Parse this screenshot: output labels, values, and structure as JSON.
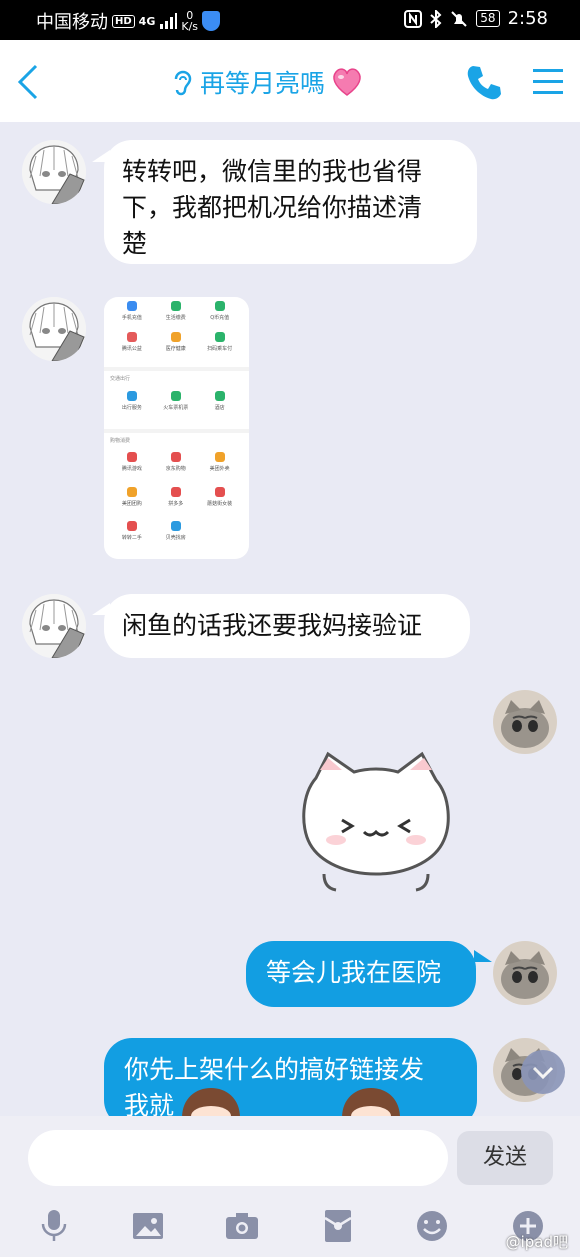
{
  "status_bar": {
    "carrier": "中国移动",
    "hd_badge": "HD",
    "network": "4G",
    "net_speed_value": "0",
    "net_speed_unit": "K/s",
    "battery": "58",
    "time": "2:58"
  },
  "header": {
    "title": "再等月亮嗎",
    "icons": [
      "back-icon",
      "ear-icon",
      "heart-icon",
      "phone-icon",
      "menu-icon"
    ]
  },
  "messages": [
    {
      "side": "in",
      "type": "text",
      "lines": [
        "转转吧，微信里的我也省得",
        "下，我都把机况给你描述清",
        "楚"
      ]
    },
    {
      "side": "in",
      "type": "image",
      "sections": [
        {
          "title": "",
          "items": [
            "手机充值",
            "生活缴费",
            "Q币充值",
            "城市服务",
            "腾讯公益",
            "医疗健康",
            "扫码乘车付"
          ],
          "note": "Bing"
        },
        {
          "title": "交通出行",
          "items": [
            "出行服务",
            "火车票机票",
            "酒店"
          ]
        },
        {
          "title": "购物消费",
          "items": [
            "腾讯游戏",
            "京东购物",
            "美团外卖",
            "电影演出赛事",
            "美团团购",
            "拼多多",
            "蘑菇街女装",
            "唯品会特卖",
            "转转二手",
            "贝壳找房"
          ]
        }
      ]
    },
    {
      "side": "in",
      "type": "text",
      "lines": [
        "闲鱼的话我还要我妈接验证"
      ]
    },
    {
      "side": "out",
      "type": "sticker",
      "sticker": "white-cat-sticker"
    },
    {
      "side": "out",
      "type": "text",
      "lines": [
        "等会儿我在医院"
      ]
    },
    {
      "side": "out",
      "type": "text",
      "lines": [
        "你先上架什么的搞好链接发",
        "我就"
      ]
    }
  ],
  "composer": {
    "input_value": "",
    "send_label": "发送",
    "tools": [
      "microphone-icon",
      "image-icon",
      "camera-icon",
      "red-packet-icon",
      "emoji-icon",
      "plus-icon"
    ]
  },
  "watermark": "@ipad吧",
  "colors": {
    "accent": "#1aa4e6",
    "outgoing_bubble": "#129ee2",
    "background": "#e9eaf4"
  }
}
